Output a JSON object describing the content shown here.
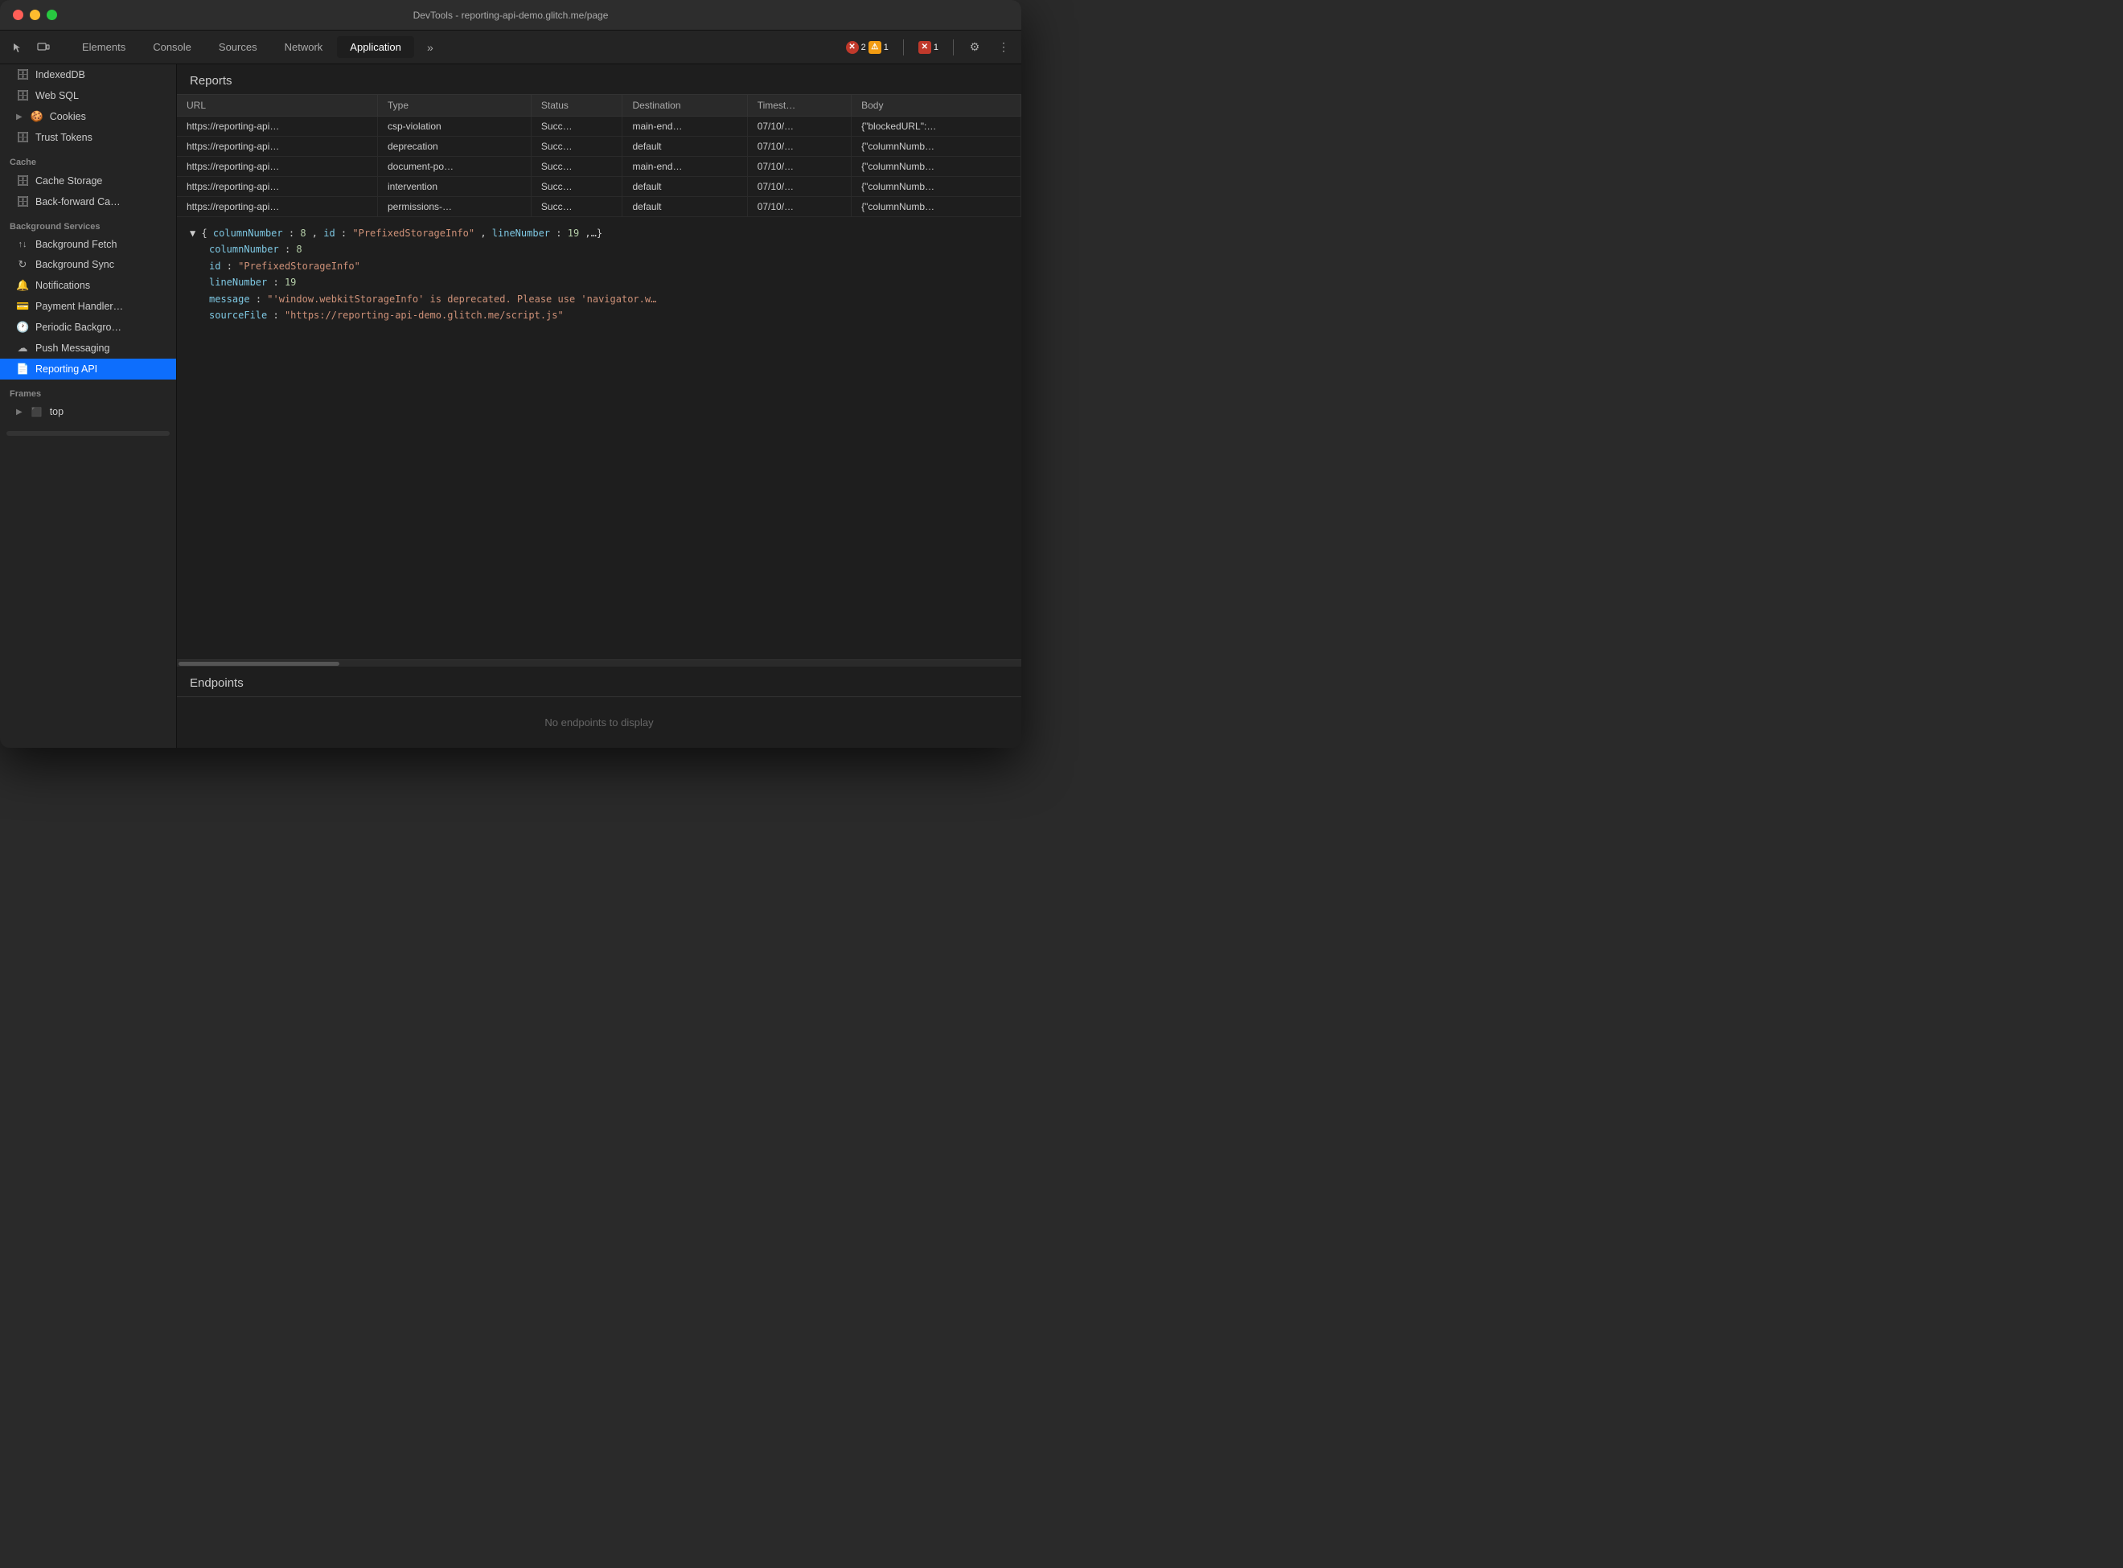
{
  "window": {
    "title": "DevTools - reporting-api-demo.glitch.me/page"
  },
  "tabs": [
    {
      "id": "elements",
      "label": "Elements",
      "active": false
    },
    {
      "id": "console",
      "label": "Console",
      "active": false
    },
    {
      "id": "sources",
      "label": "Sources",
      "active": false
    },
    {
      "id": "network",
      "label": "Network",
      "active": false
    },
    {
      "id": "application",
      "label": "Application",
      "active": true
    }
  ],
  "errors": {
    "error_count": "2",
    "warn_count": "1",
    "err2_count": "1"
  },
  "sidebar": {
    "sections": [
      {
        "items": [
          {
            "id": "indexed-db",
            "icon": "🗄",
            "label": "IndexedDB",
            "indent": false
          },
          {
            "id": "web-sql",
            "icon": "🗄",
            "label": "Web SQL",
            "indent": false
          },
          {
            "id": "cookies",
            "icon": "🍪",
            "label": "Cookies",
            "indent": false,
            "expandable": true
          },
          {
            "id": "trust-tokens",
            "icon": "🗄",
            "label": "Trust Tokens",
            "indent": false
          }
        ]
      },
      {
        "title": "Cache",
        "items": [
          {
            "id": "cache-storage",
            "icon": "🗄",
            "label": "Cache Storage",
            "indent": false
          },
          {
            "id": "back-forward",
            "icon": "🗄",
            "label": "Back-forward Ca…",
            "indent": false
          }
        ]
      },
      {
        "title": "Background Services",
        "items": [
          {
            "id": "bg-fetch",
            "icon": "↑↓",
            "label": "Background Fetch",
            "indent": false
          },
          {
            "id": "bg-sync",
            "icon": "↻",
            "label": "Background Sync",
            "indent": false
          },
          {
            "id": "notifications",
            "icon": "🔔",
            "label": "Notifications",
            "indent": false
          },
          {
            "id": "payment-handler",
            "icon": "💳",
            "label": "Payment Handler…",
            "indent": false
          },
          {
            "id": "periodic-bg",
            "icon": "🕐",
            "label": "Periodic Backgro…",
            "indent": false
          },
          {
            "id": "push-messaging",
            "icon": "☁",
            "label": "Push Messaging",
            "indent": false
          },
          {
            "id": "reporting-api",
            "icon": "📄",
            "label": "Reporting API",
            "indent": false,
            "active": true
          }
        ]
      },
      {
        "title": "Frames",
        "items": [
          {
            "id": "frame-top",
            "icon": "⬛",
            "label": "top",
            "indent": false,
            "expandable": true
          }
        ]
      }
    ]
  },
  "main": {
    "reports_title": "Reports",
    "table": {
      "columns": [
        "URL",
        "Type",
        "Status",
        "Destination",
        "Timest…",
        "Body"
      ],
      "rows": [
        {
          "url": "https://reporting-api…",
          "type": "csp-violation",
          "status": "Succ…",
          "destination": "main-end…",
          "timestamp": "07/10/…",
          "body": "{\"blockedURL\":…"
        },
        {
          "url": "https://reporting-api…",
          "type": "deprecation",
          "status": "Succ…",
          "destination": "default",
          "timestamp": "07/10/…",
          "body": "{\"columnNumb…"
        },
        {
          "url": "https://reporting-api…",
          "type": "document-po…",
          "status": "Succ…",
          "destination": "main-end…",
          "timestamp": "07/10/…",
          "body": "{\"columnNumb…"
        },
        {
          "url": "https://reporting-api…",
          "type": "intervention",
          "status": "Succ…",
          "destination": "default",
          "timestamp": "07/10/…",
          "body": "{\"columnNumb…"
        },
        {
          "url": "https://reporting-api…",
          "type": "permissions-…",
          "status": "Succ…",
          "destination": "default",
          "timestamp": "07/10/…",
          "body": "{\"columnNumb…"
        }
      ]
    },
    "json_preview": {
      "collapsed_line": "▼ {columnNumber: 8, id: \"PrefixedStorageInfo\", lineNumber: 19,…}",
      "lines": [
        {
          "key": "columnNumber",
          "value": "8",
          "type": "number"
        },
        {
          "key": "id",
          "value": "\"PrefixedStorageInfo\"",
          "type": "string"
        },
        {
          "key": "lineNumber",
          "value": "19",
          "type": "number"
        },
        {
          "key": "message",
          "value": "\"'window.webkitStorageInfo' is deprecated. Please use 'navigator.w…\"",
          "type": "string"
        },
        {
          "key": "sourceFile",
          "value": "\"https://reporting-api-demo.glitch.me/script.js\"",
          "type": "string"
        }
      ]
    },
    "endpoints_title": "Endpoints",
    "endpoints_empty": "No endpoints to display"
  }
}
